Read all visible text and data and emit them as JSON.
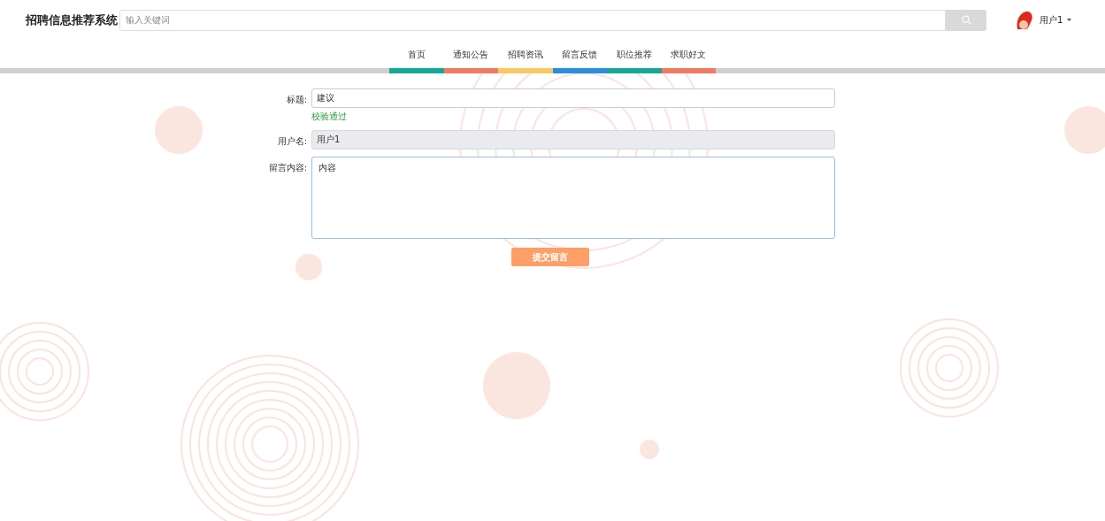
{
  "header": {
    "logo": "招聘信息推荐系统",
    "search": {
      "placeholder": "输入关键词"
    },
    "user": {
      "name": "用户1"
    }
  },
  "nav": [
    {
      "label": "首页",
      "color": "#16a897"
    },
    {
      "label": "通知公告",
      "color": "#f27b62"
    },
    {
      "label": "招聘资讯",
      "color": "#fbc864"
    },
    {
      "label": "留言反馈",
      "color": "#2b8ee0"
    },
    {
      "label": "职位推荐",
      "color": "#16a897"
    },
    {
      "label": "求职好文",
      "color": "#f27b62"
    }
  ],
  "form": {
    "fields": [
      {
        "kind": "input",
        "label": "标题:",
        "value": "建议",
        "disabled": false,
        "hint": "校验通过"
      },
      {
        "kind": "input",
        "label": "用户名:",
        "value": "用户1",
        "disabled": true
      },
      {
        "kind": "textarea",
        "label": "留言内容:",
        "value": "内容",
        "disabled": false
      }
    ],
    "submit": "提交留言"
  }
}
